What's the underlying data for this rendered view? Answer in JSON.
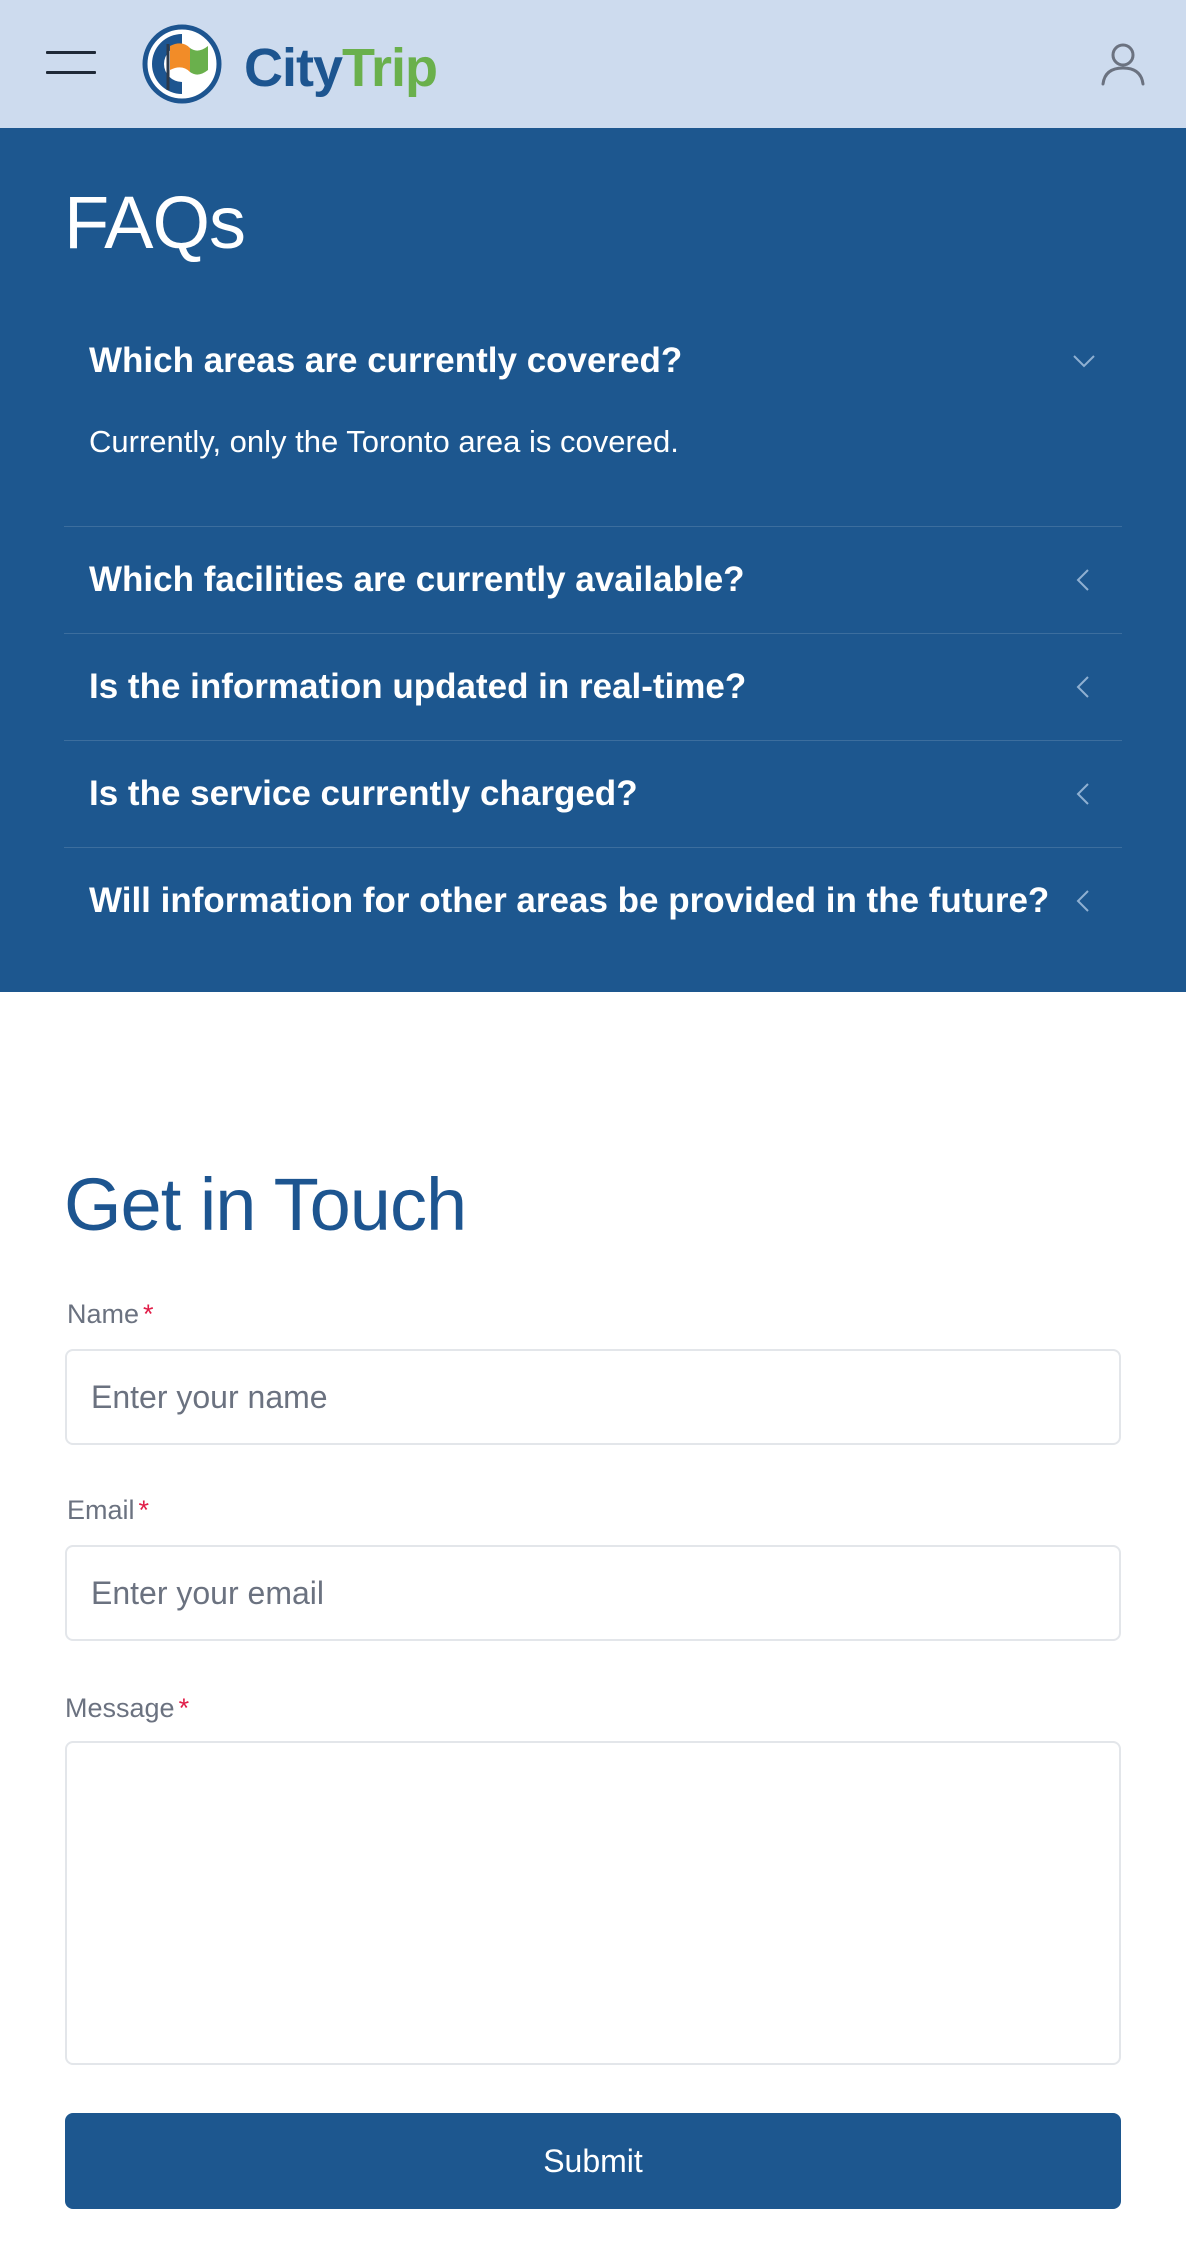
{
  "header": {
    "logo_city": "City",
    "logo_trip": "Trip",
    "icons": {
      "menu": "hamburger-menu-icon",
      "user": "user-icon"
    },
    "colors": {
      "bar": "#cddbee",
      "brand_blue": "#1d5590",
      "brand_green": "#6ab04c"
    }
  },
  "faq": {
    "title": "FAQs",
    "background": "#1d578f",
    "items": [
      {
        "question": "Which areas are currently covered?",
        "answer": "Currently, only the Toronto area is covered.",
        "open": true
      },
      {
        "question": "Which facilities are currently available?",
        "open": false
      },
      {
        "question": "Is the information updated in real-time?",
        "open": false
      },
      {
        "question": "Is the service currently charged?",
        "open": false
      },
      {
        "question": "Will information for other areas be provided in the future?",
        "open": false
      }
    ]
  },
  "contact": {
    "title": "Get in Touch",
    "required_mark": "*",
    "name": {
      "label": "Name",
      "placeholder": "Enter your name",
      "value": ""
    },
    "email": {
      "label": "Email",
      "placeholder": "Enter your email",
      "value": ""
    },
    "message": {
      "label": "Message",
      "placeholder": "",
      "value": ""
    },
    "submit_label": "Submit"
  }
}
